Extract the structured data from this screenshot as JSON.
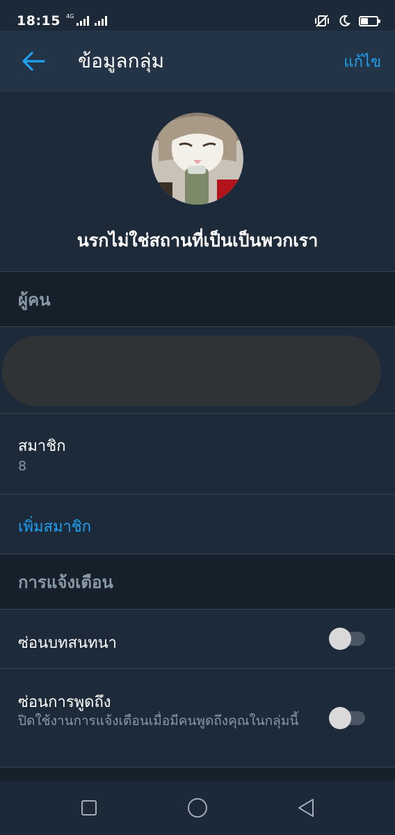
{
  "status": {
    "time": "18:15",
    "network": "4G",
    "battery_percent": 45
  },
  "header": {
    "title": "ข้อมูลกลุ่ม",
    "edit_label": "แก้ไข",
    "back_icon": "arrow-left-icon"
  },
  "group": {
    "name": "นรกไม่ใช่สถานที่เป็นเป็นพวกเรา"
  },
  "people_section": {
    "title": "ผู้คน"
  },
  "members": {
    "label": "สมาชิก",
    "count": "8",
    "add_label": "เพิ่มสมาชิก"
  },
  "notifications_section": {
    "title": "การแจ้งเตือน",
    "items": [
      {
        "label": "ซ่อนบทสนทนา",
        "enabled": false
      },
      {
        "label": "ซ่อนการพูดถึง",
        "description": "ปิดใช้งานการแจ้งเตือนเมื่อมีคนพูดถึงคุณในกลุ่มนี้",
        "enabled": false
      }
    ]
  },
  "colors": {
    "accent": "#1da1f2",
    "background": "#1d2a39",
    "header": "#243447",
    "section": "#15202b"
  },
  "nav": {
    "recents_icon": "square-icon",
    "home_icon": "circle-icon",
    "back_icon": "triangle-back-icon"
  }
}
